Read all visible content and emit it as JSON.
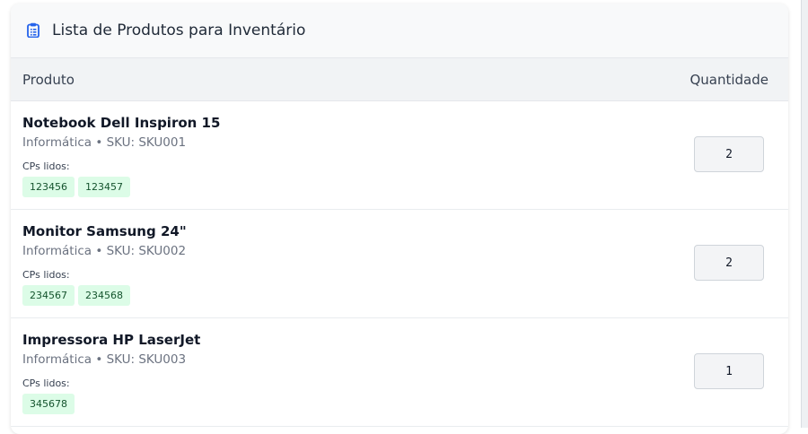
{
  "header": {
    "title": "Lista de Produtos para Inventário",
    "icon": "clipboard-list-icon"
  },
  "table": {
    "col_product": "Produto",
    "col_quantity": "Quantidade",
    "cps_label": "CPs lidos:",
    "rows": [
      {
        "name": "Notebook Dell Inspiron 15",
        "meta": "Informática • SKU: SKU001",
        "cps": [
          "123456",
          "123457"
        ],
        "quantity": "2"
      },
      {
        "name": "Monitor Samsung 24\"",
        "meta": "Informática • SKU: SKU002",
        "cps": [
          "234567",
          "234568"
        ],
        "quantity": "2"
      },
      {
        "name": "Impressora HP LaserJet",
        "meta": "Informática • SKU: SKU003",
        "cps": [
          "345678"
        ],
        "quantity": "1"
      }
    ]
  },
  "colors": {
    "accent": "#2563eb",
    "tag_bg": "#dcfce7",
    "tag_text": "#14532d"
  }
}
